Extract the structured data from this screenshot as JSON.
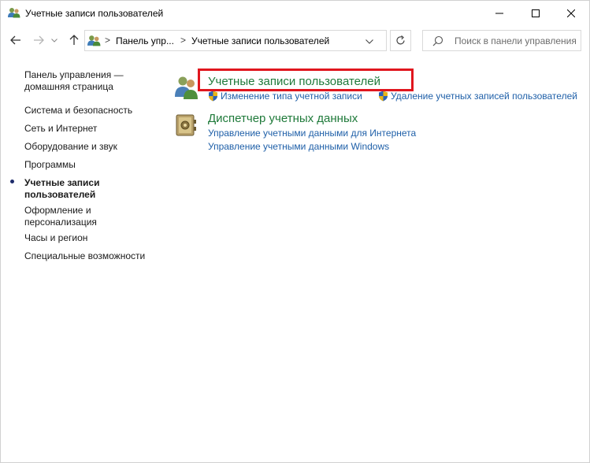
{
  "window": {
    "title": "Учетные записи пользователей"
  },
  "address_bar": {
    "crumbs": [
      "Панель упр...",
      "Учетные записи пользователей"
    ],
    "separator": ">"
  },
  "search": {
    "placeholder": "Поиск в панели управления"
  },
  "sidebar": {
    "items": [
      {
        "label_line1": "Панель управления —",
        "label_line2": "домашняя страница"
      },
      {
        "label": "Система и безопасность"
      },
      {
        "label": "Сеть и Интернет"
      },
      {
        "label": "Оборудование и звук"
      },
      {
        "label": "Программы"
      },
      {
        "label_line1": "Учетные записи",
        "label_line2": "пользователей",
        "active": true
      },
      {
        "label_line1": "Оформление и",
        "label_line2": "персонализация"
      },
      {
        "label": "Часы и регион"
      },
      {
        "label": "Специальные возможности"
      }
    ]
  },
  "main": {
    "categories": [
      {
        "title": "Учетные записи пользователей",
        "icon": "users-icon",
        "links": [
          "Изменение типа учетной записи",
          "Удаление учетных записей пользователей"
        ]
      },
      {
        "title": "Диспетчер учетных данных",
        "icon": "credential-manager-icon",
        "links": [
          "Управление учетными данными для Интернета",
          "Управление учетными данными Windows"
        ]
      }
    ]
  },
  "colors": {
    "category_title": "#1f7a3a",
    "link": "#1e5fa8",
    "highlight": "#e0161e"
  }
}
